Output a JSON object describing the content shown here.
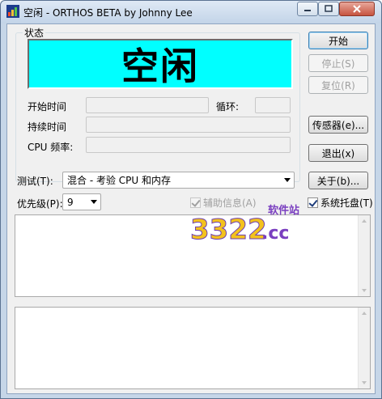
{
  "window": {
    "title": "空闲 - ORTHOS BETA by Johnny Lee"
  },
  "status_group": {
    "legend": "状态",
    "status_value": "空闲",
    "status_bg_color": "#00ffff"
  },
  "fields": {
    "start_time_label": "开始时间",
    "start_time_value": "",
    "loop_label": "循环:",
    "loop_value": "",
    "duration_label": "持续时间",
    "duration_value": "",
    "cpu_freq_label": "CPU 频率:",
    "cpu_freq_value": ""
  },
  "buttons": {
    "start": "开始",
    "stop": "停止(S)",
    "reset": "复位(R)",
    "sensors": "传感器(e)...",
    "exit": "退出(x)",
    "about": "关于(b)..."
  },
  "test": {
    "label": "测试(T):",
    "selected": "混合 - 考验 CPU 和内存"
  },
  "priority": {
    "label": "优先级(P):",
    "selected": "9"
  },
  "checkboxes": {
    "aux_info_label": "辅助信息(A)",
    "aux_info_checked": true,
    "aux_info_enabled": false,
    "tray_label": "系统托盘(T)",
    "tray_checked": true
  },
  "logs": {
    "log1_text": "",
    "log2_text": ""
  },
  "watermark": {
    "number_text": "3322",
    "domain_text": ".cc",
    "tagline": "软件站"
  }
}
